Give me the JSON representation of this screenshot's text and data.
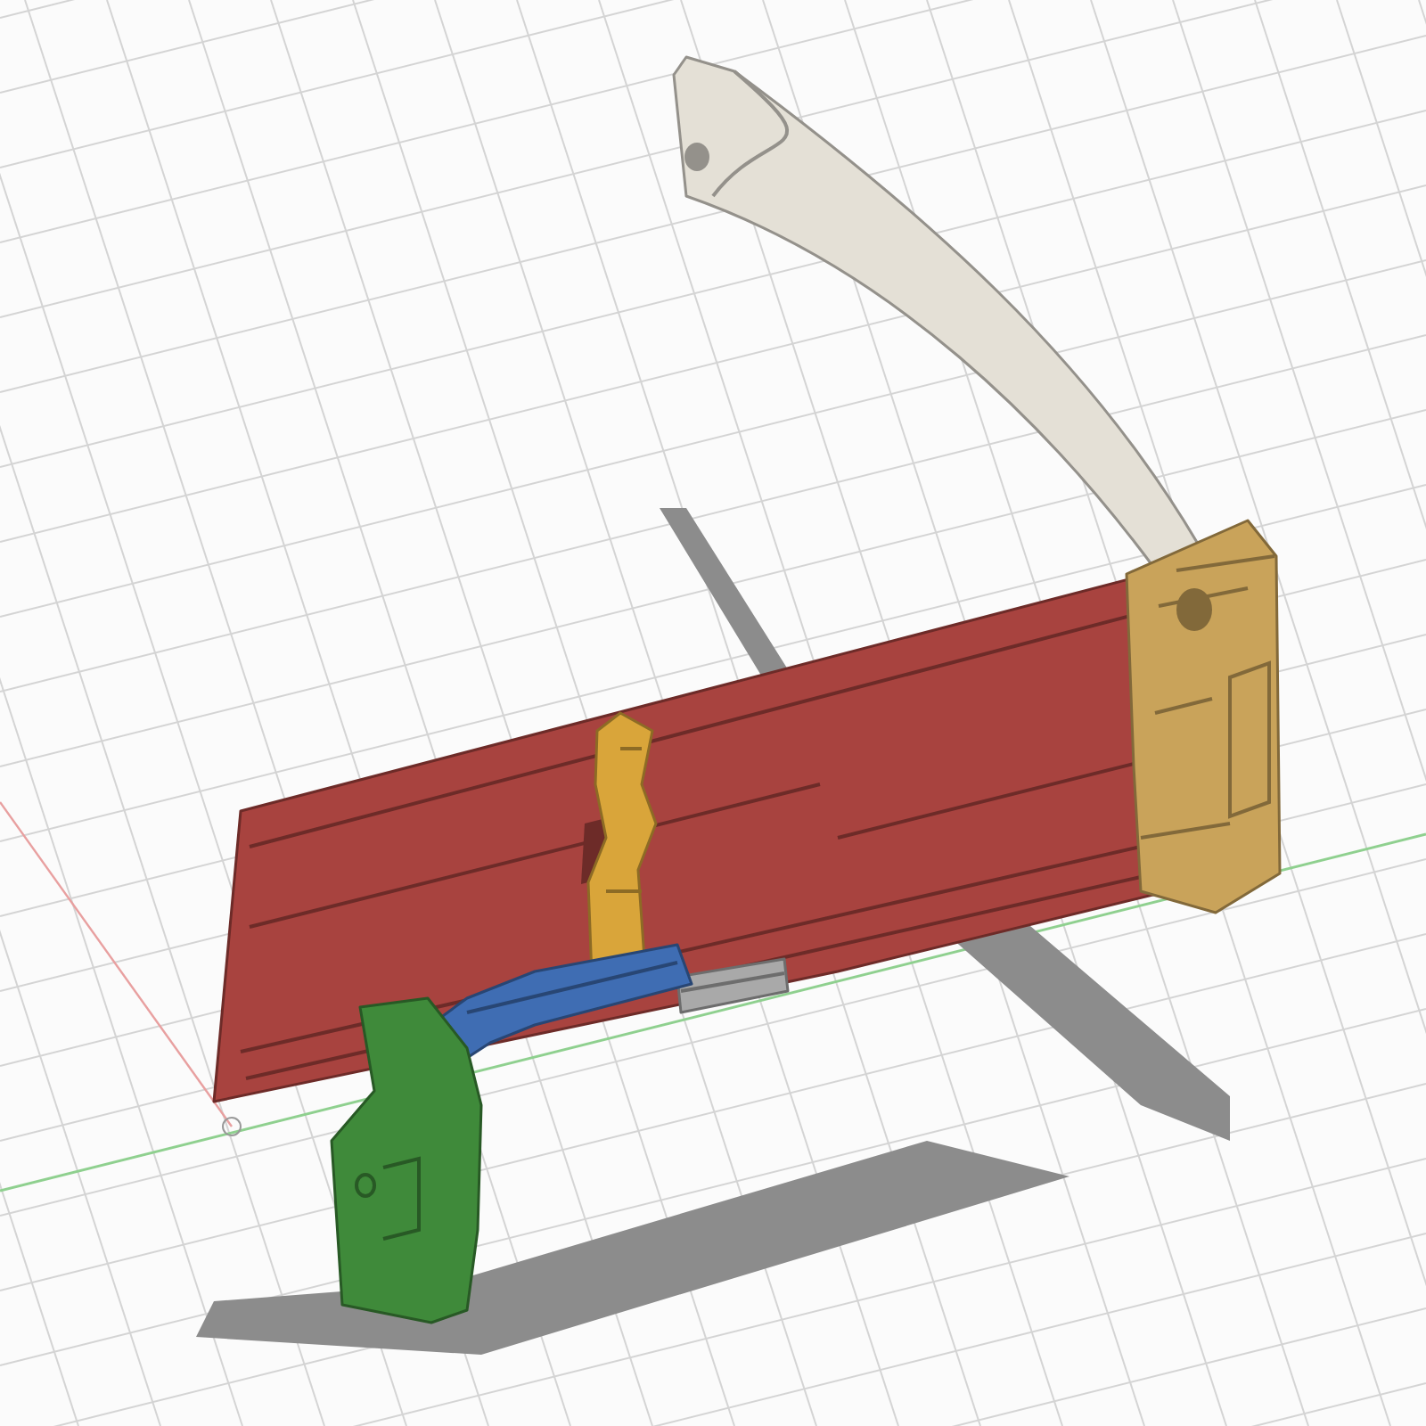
{
  "parts": [
    {
      "kind": "limb",
      "color": "#e4e0d6"
    },
    {
      "kind": "rail",
      "color": "#a8433f"
    },
    {
      "kind": "end_block",
      "color": "#c9a35a"
    },
    {
      "kind": "latch",
      "color": "#d9a53a"
    },
    {
      "kind": "catch",
      "color": "#a9a9a9"
    },
    {
      "kind": "lever",
      "color": "#3f6db3"
    },
    {
      "kind": "trigger",
      "color": "#3f8a3a"
    }
  ]
}
